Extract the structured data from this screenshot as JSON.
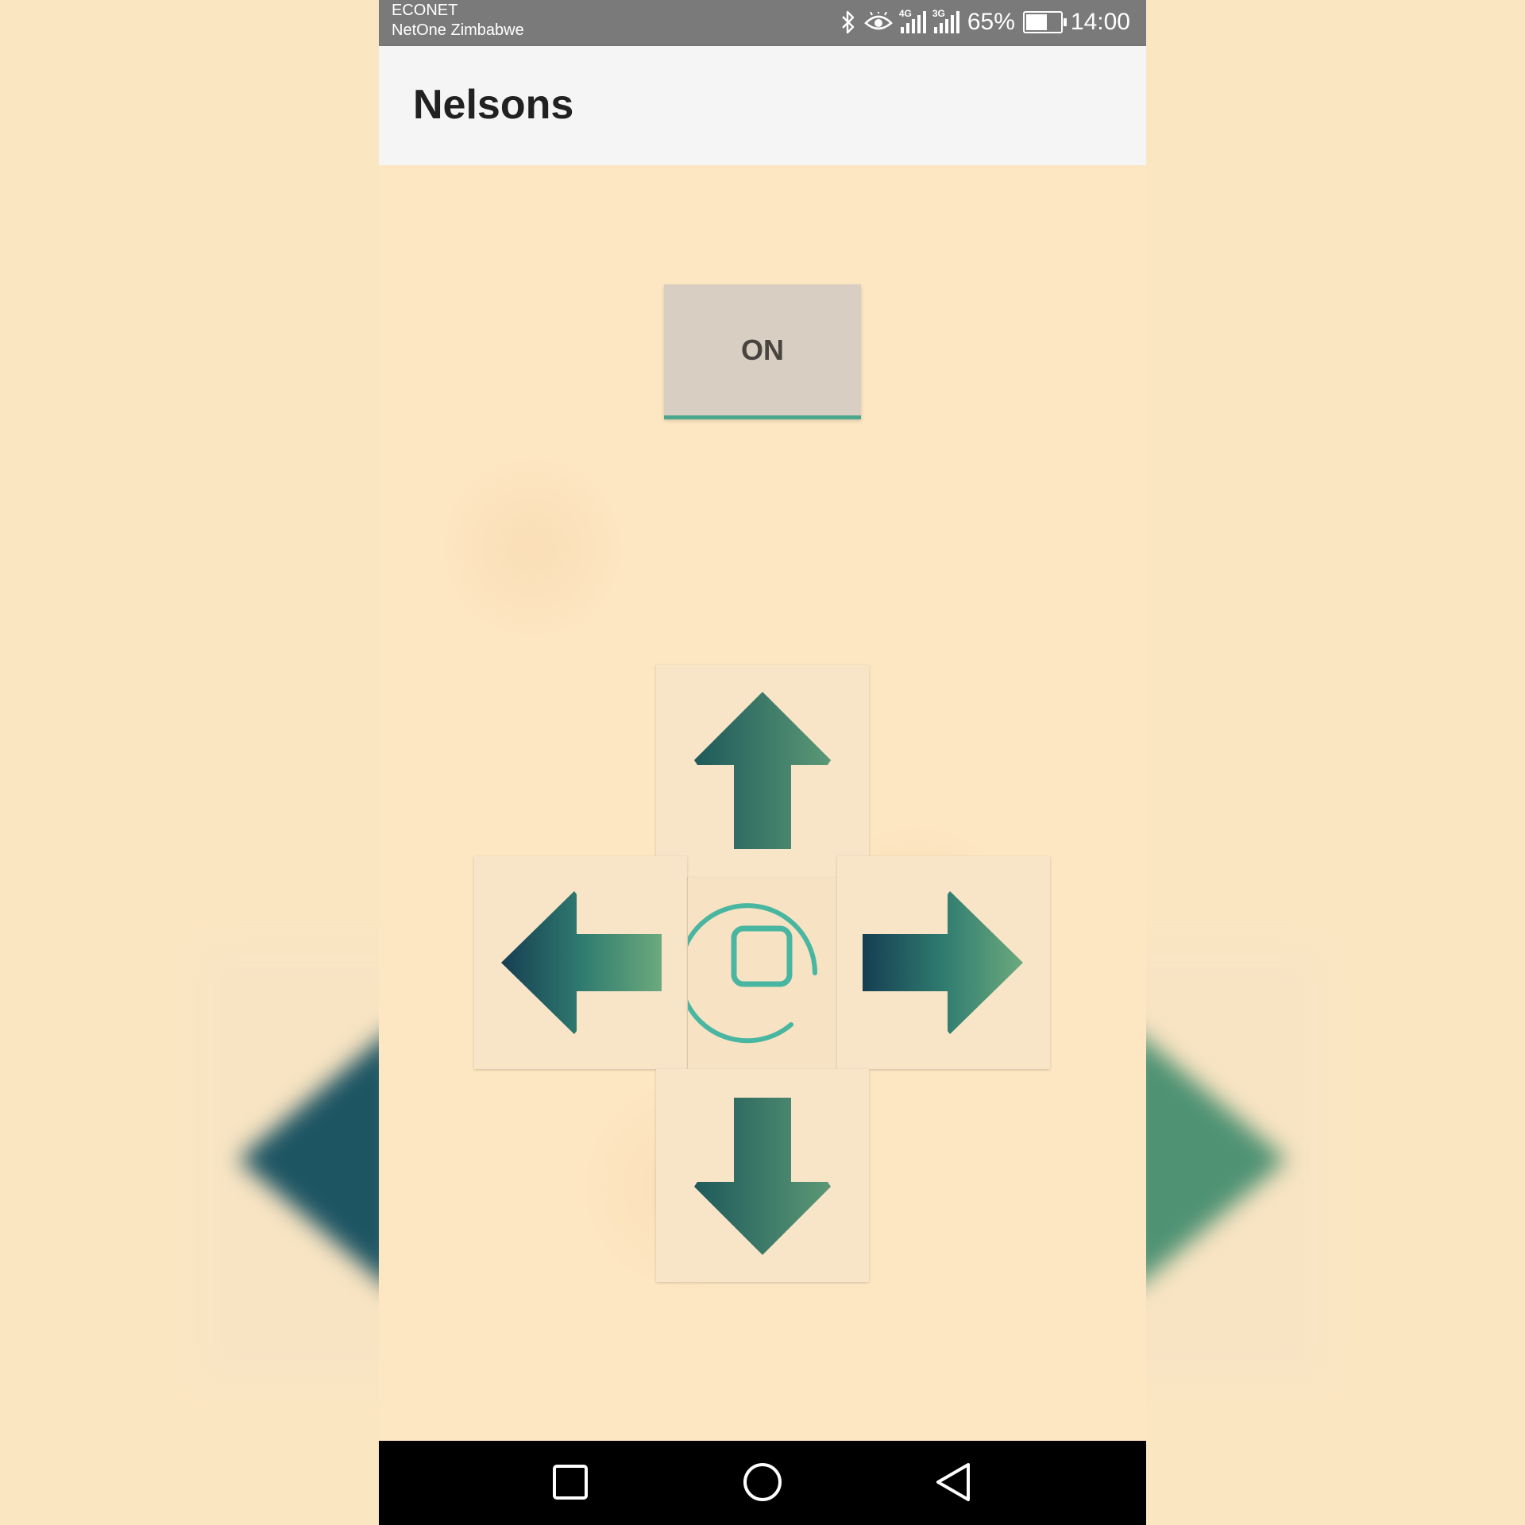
{
  "status_bar": {
    "carrier_primary": "ECONET",
    "carrier_secondary": "NetOne Zimbabwe",
    "network_1": "4G",
    "network_2": "3G",
    "battery_percent": "65%",
    "time": "14:00",
    "icons": [
      "bluetooth-icon",
      "eye-icon",
      "signal-icon",
      "signal-icon",
      "battery-icon"
    ]
  },
  "app_bar": {
    "title": "Nelsons"
  },
  "controls": {
    "power_button_label": "ON",
    "directions": [
      "up",
      "left",
      "stop",
      "right",
      "down"
    ]
  },
  "navigation_bar": {
    "buttons": [
      "recents",
      "home",
      "back"
    ]
  },
  "colors": {
    "arrow_dark": "#173f52",
    "arrow_mid": "#2f7a70",
    "arrow_light": "#6aa87c",
    "accent_teal": "#48b6a0",
    "background": "#fde6c2",
    "status_bar": "#7a7a7a",
    "app_bar": "#f5f5f5",
    "button_bg": "#d8cfc2"
  }
}
